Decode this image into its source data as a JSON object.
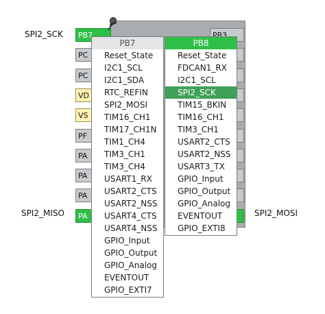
{
  "signals": {
    "left_top": "SPI2_SCK",
    "left_bottom": "SPI2_MISO",
    "right_bottom": "SPI2_MOSI"
  },
  "pins_left": [
    {
      "label": "PB7",
      "style": "green"
    },
    {
      "label": "PC",
      "style": "gray"
    },
    {
      "label": "PC",
      "style": "gray"
    },
    {
      "label": "VD",
      "style": "yellow"
    },
    {
      "label": "VS",
      "style": "yellow"
    },
    {
      "label": "PF",
      "style": "gray"
    },
    {
      "label": "PA",
      "style": "gray"
    },
    {
      "label": "PA",
      "style": "gray"
    },
    {
      "label": "PA",
      "style": "gray"
    },
    {
      "label": "PA",
      "style": "green"
    }
  ],
  "pins_right": [
    {
      "label": "PB3",
      "style": "gray"
    },
    {
      "label": "",
      "style": "gray"
    },
    {
      "label": "",
      "style": "gray"
    },
    {
      "label": "",
      "style": "gray"
    },
    {
      "label": "",
      "style": "gray"
    },
    {
      "label": "",
      "style": "gray"
    },
    {
      "label": "",
      "style": "gray"
    },
    {
      "label": "",
      "style": "gray"
    },
    {
      "label": "",
      "style": "gray"
    },
    {
      "label": "",
      "style": "green"
    }
  ],
  "menu_pb7": {
    "title": "PB7",
    "items": [
      "Reset_State",
      "I2C1_SCL",
      "I2C1_SDA",
      "RTC_REFIN",
      "SPI2_MOSI",
      "TIM16_CH1",
      "TIM17_CH1N",
      "TIM1_CH4",
      "TIM3_CH1",
      "TIM3_CH4",
      "USART1_RX",
      "USART2_CTS",
      "USART2_NSS",
      "USART4_CTS",
      "USART4_NSS",
      "GPIO_Input",
      "GPIO_Output",
      "GPIO_Analog",
      "EVENTOUT",
      "GPIO_EXTI7"
    ]
  },
  "menu_pb8": {
    "title": "PB8",
    "items": [
      "Reset_State",
      "FDCAN1_RX",
      "I2C1_SCL",
      "SPI2_SCK",
      "TIM15_BKIN",
      "TIM16_CH1",
      "TIM3_CH1",
      "USART2_CTS",
      "USART2_NSS",
      "USART3_TX",
      "GPIO_Input",
      "GPIO_Output",
      "GPIO_Analog",
      "EVENTOUT",
      "GPIO_EXTI8"
    ],
    "selected": "SPI2_SCK"
  },
  "colors": {
    "pin_green": "#2fbf48",
    "selection": "#3fa057",
    "chip_gray": "#a9adb0",
    "power_yellow": "#fff2b2"
  },
  "icons": {
    "pin": "pushpin-icon"
  }
}
